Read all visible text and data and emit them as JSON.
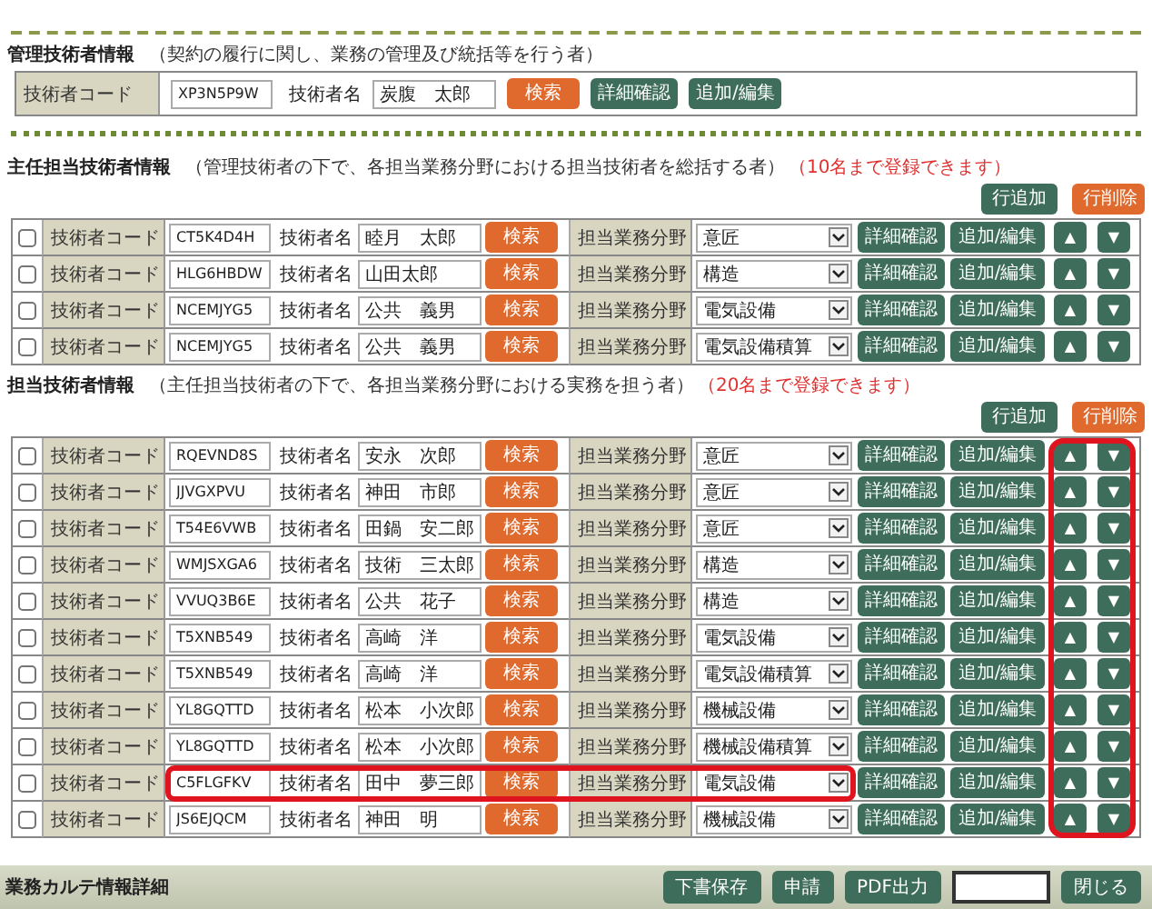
{
  "manager": {
    "title": "管理技術者情報",
    "note": "（契約の履行に関し、業務の管理及び統括等を行う者）",
    "code_label": "技術者コード",
    "code": "XP3N5P9W",
    "name_label": "技術者名",
    "name": "炭腹　太郎",
    "search": "検索",
    "detail": "詳細確認",
    "edit": "追加/編集"
  },
  "sections": [
    {
      "title": "主任担当技術者情報",
      "note": "（管理技術者の下で、各担当業務分野における担当技術者を総括する者）",
      "limit_note": "（10名まで登録できます）",
      "add_button": "行追加",
      "delete_button": "行削除",
      "order_frame": false,
      "rows": [
        {
          "checked": false,
          "code_label": "技術者コード",
          "code": "CT5K4D4H",
          "name_label": "技術者名",
          "name": "睦月　太郎",
          "search": "検索",
          "field_label": "担当業務分野",
          "field": "意匠",
          "detail": "詳細確認",
          "edit": "追加/編集",
          "up": "▲",
          "down": "▼",
          "highlighted": false
        },
        {
          "checked": false,
          "code_label": "技術者コード",
          "code": "HLG6HBDW",
          "name_label": "技術者名",
          "name": "山田太郎",
          "search": "検索",
          "field_label": "担当業務分野",
          "field": "構造",
          "detail": "詳細確認",
          "edit": "追加/編集",
          "up": "▲",
          "down": "▼",
          "highlighted": false
        },
        {
          "checked": false,
          "code_label": "技術者コード",
          "code": "NCEMJYG5",
          "name_label": "技術者名",
          "name": "公共　義男",
          "search": "検索",
          "field_label": "担当業務分野",
          "field": "電気設備",
          "detail": "詳細確認",
          "edit": "追加/編集",
          "up": "▲",
          "down": "▼",
          "highlighted": false
        },
        {
          "checked": false,
          "code_label": "技術者コード",
          "code": "NCEMJYG5",
          "name_label": "技術者名",
          "name": "公共　義男",
          "search": "検索",
          "field_label": "担当業務分野",
          "field": "電気設備積算",
          "detail": "詳細確認",
          "edit": "追加/編集",
          "up": "▲",
          "down": "▼",
          "highlighted": false
        }
      ]
    },
    {
      "title": "担当技術者情報",
      "note": "（主任担当技術者の下で、各担当業務分野における実務を担う者）",
      "limit_note": "（20名まで登録できます）",
      "add_button": "行追加",
      "delete_button": "行削除",
      "order_frame": true,
      "rows": [
        {
          "checked": false,
          "code_label": "技術者コード",
          "code": "RQEVND8S",
          "name_label": "技術者名",
          "name": "安永　次郎",
          "search": "検索",
          "field_label": "担当業務分野",
          "field": "意匠",
          "detail": "詳細確認",
          "edit": "追加/編集",
          "up": "▲",
          "down": "▼",
          "highlighted": false
        },
        {
          "checked": false,
          "code_label": "技術者コード",
          "code": "JJVGXPVU",
          "name_label": "技術者名",
          "name": "神田　市郎",
          "search": "検索",
          "field_label": "担当業務分野",
          "field": "意匠",
          "detail": "詳細確認",
          "edit": "追加/編集",
          "up": "▲",
          "down": "▼",
          "highlighted": false
        },
        {
          "checked": false,
          "code_label": "技術者コード",
          "code": "T54E6VWB",
          "name_label": "技術者名",
          "name": "田鍋　安二郎",
          "search": "検索",
          "field_label": "担当業務分野",
          "field": "意匠",
          "detail": "詳細確認",
          "edit": "追加/編集",
          "up": "▲",
          "down": "▼",
          "highlighted": false
        },
        {
          "checked": false,
          "code_label": "技術者コード",
          "code": "WMJSXGA6",
          "name_label": "技術者名",
          "name": "技術　三太郎",
          "search": "検索",
          "field_label": "担当業務分野",
          "field": "構造",
          "detail": "詳細確認",
          "edit": "追加/編集",
          "up": "▲",
          "down": "▼",
          "highlighted": false
        },
        {
          "checked": false,
          "code_label": "技術者コード",
          "code": "VVUQ3B6E",
          "name_label": "技術者名",
          "name": "公共　花子",
          "search": "検索",
          "field_label": "担当業務分野",
          "field": "構造",
          "detail": "詳細確認",
          "edit": "追加/編集",
          "up": "▲",
          "down": "▼",
          "highlighted": false
        },
        {
          "checked": false,
          "code_label": "技術者コード",
          "code": "T5XNB549",
          "name_label": "技術者名",
          "name": "高崎　洋",
          "search": "検索",
          "field_label": "担当業務分野",
          "field": "電気設備",
          "detail": "詳細確認",
          "edit": "追加/編集",
          "up": "▲",
          "down": "▼",
          "highlighted": false
        },
        {
          "checked": false,
          "code_label": "技術者コード",
          "code": "T5XNB549",
          "name_label": "技術者名",
          "name": "高崎　洋",
          "search": "検索",
          "field_label": "担当業務分野",
          "field": "電気設備積算",
          "detail": "詳細確認",
          "edit": "追加/編集",
          "up": "▲",
          "down": "▼",
          "highlighted": false
        },
        {
          "checked": false,
          "code_label": "技術者コード",
          "code": "YL8GQTTD",
          "name_label": "技術者名",
          "name": "松本　小次郎",
          "search": "検索",
          "field_label": "担当業務分野",
          "field": "機械設備",
          "detail": "詳細確認",
          "edit": "追加/編集",
          "up": "▲",
          "down": "▼",
          "highlighted": false
        },
        {
          "checked": false,
          "code_label": "技術者コード",
          "code": "YL8GQTTD",
          "name_label": "技術者名",
          "name": "松本　小次郎",
          "search": "検索",
          "field_label": "担当業務分野",
          "field": "機械設備積算",
          "detail": "詳細確認",
          "edit": "追加/編集",
          "up": "▲",
          "down": "▼",
          "highlighted": false
        },
        {
          "checked": false,
          "code_label": "技術者コード",
          "code": "C5FLGFKV",
          "name_label": "技術者名",
          "name": "田中　夢三郎",
          "search": "検索",
          "field_label": "担当業務分野",
          "field": "電気設備",
          "detail": "詳細確認",
          "edit": "追加/編集",
          "up": "▲",
          "down": "▼",
          "highlighted": true
        },
        {
          "checked": false,
          "code_label": "技術者コード",
          "code": "JS6EJQCM",
          "name_label": "技術者名",
          "name": "神田　明",
          "search": "検索",
          "field_label": "担当業務分野",
          "field": "機械設備",
          "detail": "詳細確認",
          "edit": "追加/編集",
          "up": "▲",
          "down": "▼",
          "highlighted": false
        }
      ]
    }
  ],
  "footer": {
    "title": "業務カルテ情報詳細",
    "buttons": [
      "下書保存",
      "申請",
      "PDF出力"
    ],
    "close_button": "閉じる"
  }
}
